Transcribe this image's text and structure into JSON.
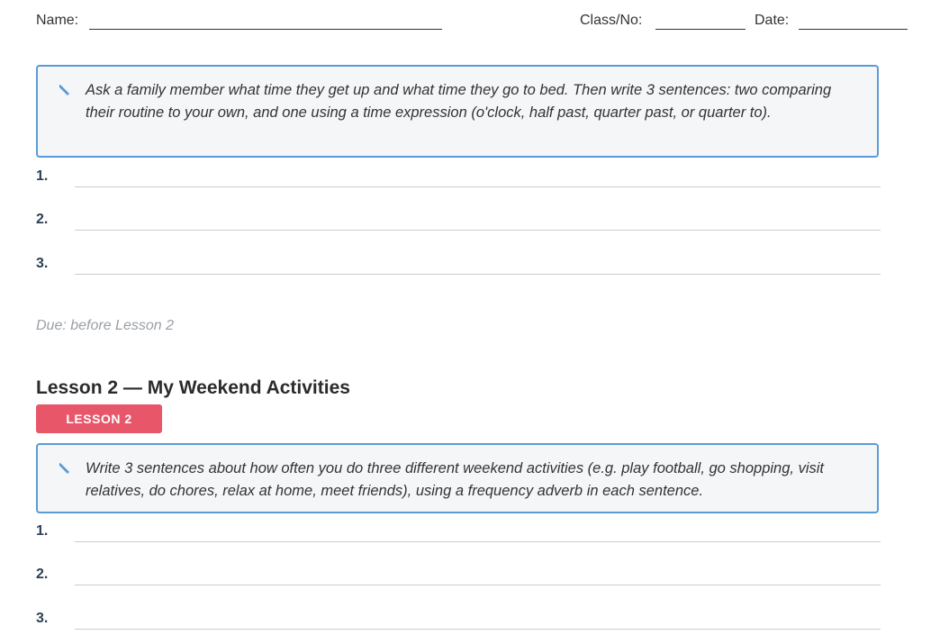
{
  "header": {
    "name_label": "Name:",
    "class_label": "Class/No:",
    "date_label": "Date:"
  },
  "section1": {
    "instruction": "Ask a family member what time they get up and what time they go to bed. Then write 3 sentences: two comparing their routine to your own, and one using a time expression (o'clock, half past, quarter past, or quarter to).",
    "answers": [
      "1.",
      "2.",
      "3."
    ],
    "due": "Due: before Lesson 2"
  },
  "section2": {
    "title": "Lesson 2 — My Weekend Activities",
    "badge": "LESSON 2",
    "instruction": "Write 3 sentences about how often you do three different weekend activities (e.g. play football, go shopping, visit relatives, do chores, relax at home, meet friends), using a frequency adverb in each sentence.",
    "answers": [
      "1.",
      "2.",
      "3."
    ]
  },
  "icons": {
    "task_icon": "pencil-icon"
  },
  "colors": {
    "box_border": "#5b9bd5",
    "badge_bg": "#e8566a"
  }
}
